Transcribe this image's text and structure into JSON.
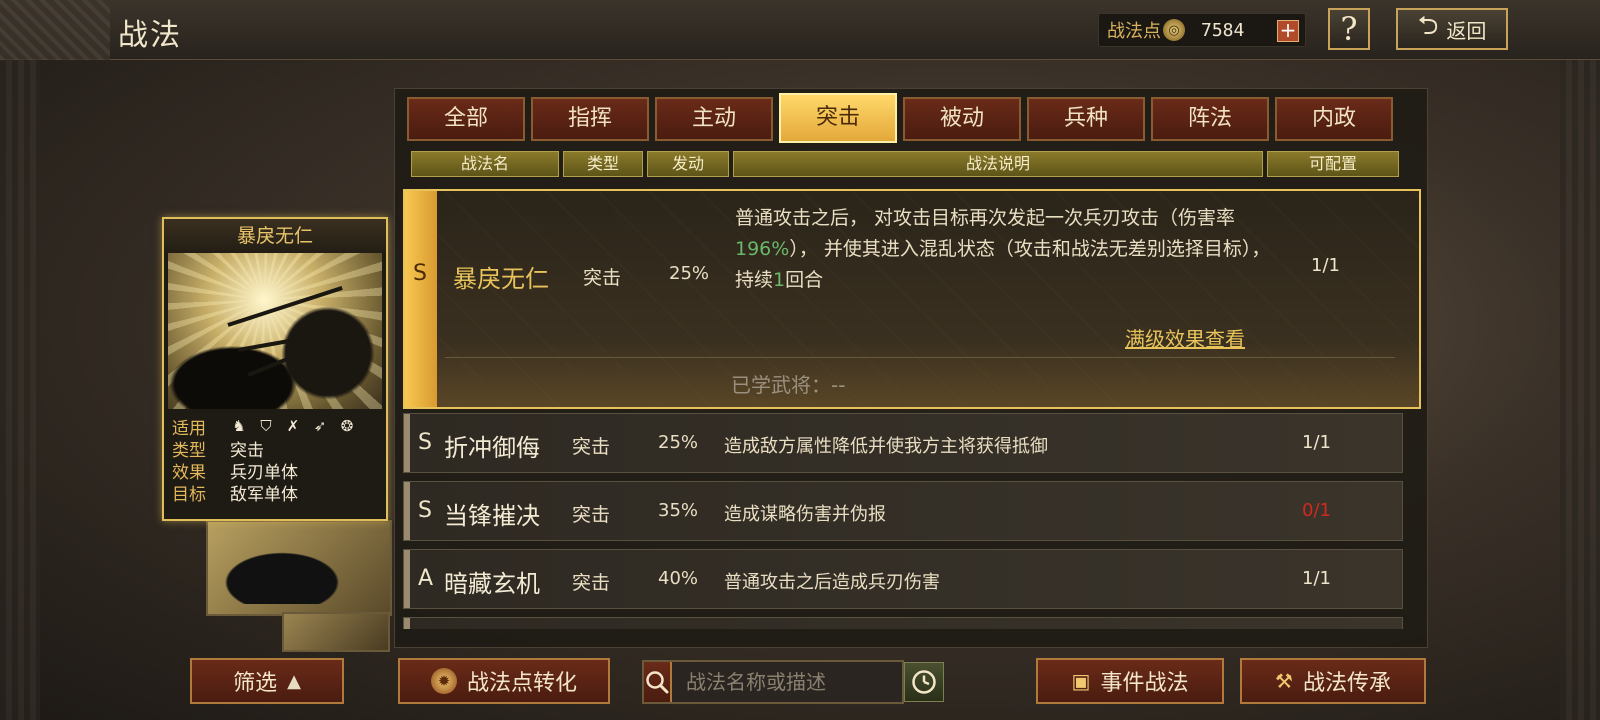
{
  "header": {
    "title": "战法",
    "points_label": "战法点",
    "points_value": "7584",
    "plus": "+",
    "help": "?",
    "back_label": "返回"
  },
  "card": {
    "name": "暴戾无仁",
    "rows": [
      {
        "key": "适用",
        "value": ""
      },
      {
        "key": "类型",
        "value": "突击"
      },
      {
        "key": "效果",
        "value": "兵刃单体"
      },
      {
        "key": "目标",
        "value": "敌军单体"
      }
    ],
    "troop_icons": [
      "cavalry-icon",
      "shield-icon",
      "bow-icon",
      "spear-icon",
      "chariot-icon"
    ]
  },
  "tabs": [
    "全部",
    "指挥",
    "主动",
    "突击",
    "被动",
    "兵种",
    "阵法",
    "内政"
  ],
  "active_tab": "突击",
  "columns": [
    "战法名",
    "类型",
    "发动",
    "战法说明",
    "可配置"
  ],
  "selected": {
    "grade": "S",
    "name": "暴戾无仁",
    "type": "突击",
    "rate": "25%",
    "desc_1": "普通攻击之后， 对攻击目标再次发起一次兵刃攻击（伤害率",
    "desc_pct": "196%",
    "desc_2": "）， 并使其进入混乱状态（攻击和战法无差别选择目标）， 持续",
    "desc_turns": "1",
    "desc_3": "回合",
    "count": "1/1",
    "link": "满级效果查看",
    "learned": "已学武将：--"
  },
  "rows": [
    {
      "grade": "S",
      "name": "折冲御侮",
      "type": "突击",
      "rate": "25%",
      "desc": "造成敌方属性降低并使我方主将获得抵御",
      "count": "1/1"
    },
    {
      "grade": "S",
      "name": "当锋摧决",
      "type": "突击",
      "rate": "35%",
      "desc": "造成谋略伤害并伪报",
      "count": "0/1"
    },
    {
      "grade": "A",
      "name": "暗藏玄机",
      "type": "突击",
      "rate": "40%",
      "desc": "普通攻击之后造成兵刃伤害",
      "count": "1/1"
    }
  ],
  "bottom": {
    "filter_label": "筛选",
    "convert_label": "战法点转化",
    "search_placeholder": "战法名称或描述",
    "event_label": "事件战法",
    "inherit_label": "战法传承"
  },
  "colors": {
    "accent_gold": "#e8c35a",
    "tab_red": "#6a2a18",
    "warning_red": "#d02a20",
    "highlight_green": "#6ab86a"
  }
}
